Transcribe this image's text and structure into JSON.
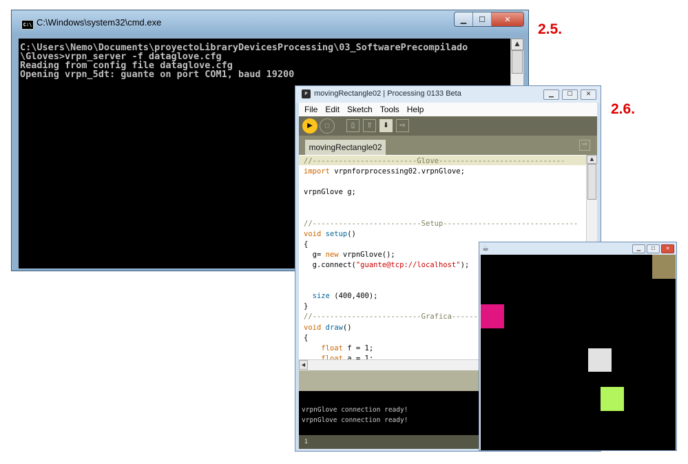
{
  "cmd_window": {
    "title": "C:\\Windows\\system32\\cmd.exe",
    "icon": "cmd-icon",
    "minimize": "▁",
    "maximize": "☐",
    "close": "✕",
    "console_lines": [
      "C:\\Users\\Nemo\\Documents\\proyectoLibraryDevicesProcessing\\03_SoftwarePrecompilado",
      "\\Gloves>vrpn_server -f dataglove.cfg",
      "Reading from config file dataglove.cfg",
      "Opening vrpn_5dt: guante on port COM1, baud 19200"
    ]
  },
  "labels": {
    "step_a": "2.5.",
    "step_b": "2.6."
  },
  "processing_window": {
    "title": "movingRectangle02 | Processing 0133 Beta",
    "menus": [
      "File",
      "Edit",
      "Sketch",
      "Tools",
      "Help"
    ],
    "toolbar_icons": [
      "run-icon",
      "stop-icon",
      "new-icon",
      "open-icon",
      "save-icon",
      "export-icon"
    ],
    "tab": "movingRectangle02",
    "output_lines": [
      "vrpnGlove connection ready!",
      "vrpnGlove connection ready!"
    ],
    "line_number": "1"
  },
  "sketch_window": {
    "icon": "java-icon",
    "background": "#000000",
    "rectangles": [
      {
        "name": "olive-rectangle",
        "color": "#998a5c"
      },
      {
        "name": "magenta-rectangle",
        "color": "#e0157f"
      },
      {
        "name": "light-gray-rectangle",
        "color": "#e2e2e2"
      },
      {
        "name": "lime-rectangle",
        "color": "#b3f55c"
      }
    ]
  },
  "colors": {
    "accent_label": "#e00000",
    "run_button": "#fdc41d",
    "processing_toolbar": "#6b6b5a"
  }
}
